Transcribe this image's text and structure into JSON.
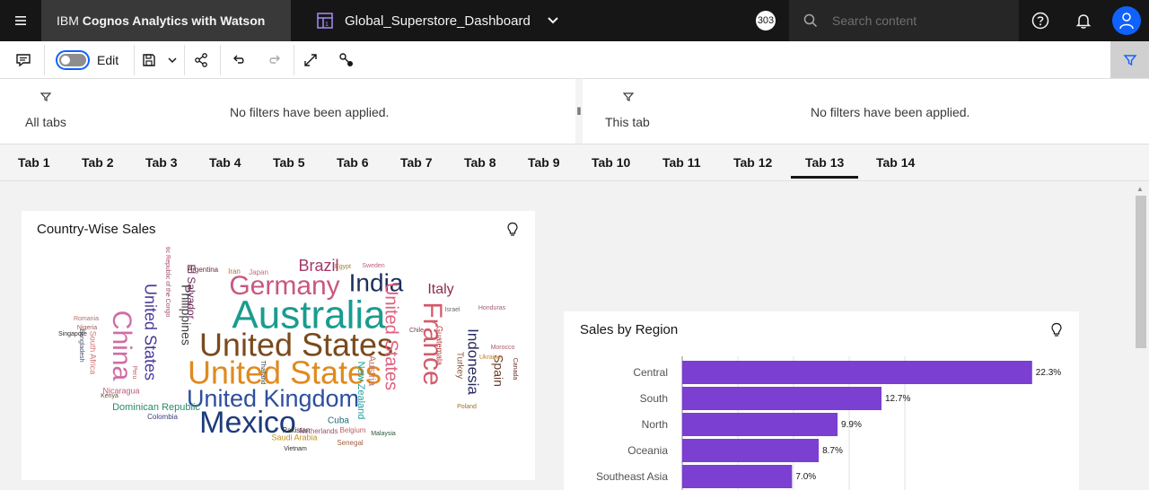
{
  "app": {
    "title_prefix": "IBM ",
    "title_brand": "Cognos Analytics with Watson",
    "dashboard_name": "Global_Superstore_Dashboard",
    "notification_badge": "303",
    "search_placeholder": "Search content"
  },
  "toolbar": {
    "edit_label": "Edit",
    "edit_mode": false
  },
  "filters": {
    "all_tabs_label": "All tabs",
    "all_tabs_message": "No filters have been applied.",
    "this_tab_label": "This tab",
    "this_tab_message": "No filters have been applied.",
    "splitter_glyph": "‖"
  },
  "tabs": [
    "Tab 1",
    "Tab 2",
    "Tab 3",
    "Tab 4",
    "Tab 5",
    "Tab 6",
    "Tab 7",
    "Tab 8",
    "Tab 9",
    "Tab 10",
    "Tab 11",
    "Tab 12",
    "Tab 13",
    "Tab 14"
  ],
  "active_tab": "Tab 13",
  "wordcloud": {
    "title": "Country-Wise Sales",
    "words": [
      {
        "text": "Australia",
        "color": "#1a9c8f"
      },
      {
        "text": "United States",
        "color": "#7a4a1d"
      },
      {
        "text": "United States",
        "color": "#e08a1e"
      },
      {
        "text": "Germany",
        "color": "#c9577f"
      },
      {
        "text": "India",
        "color": "#1e2f5c"
      },
      {
        "text": "United Kingdom",
        "color": "#2d4f9e"
      },
      {
        "text": "Mexico",
        "color": "#1e3b7a"
      },
      {
        "text": "France",
        "color": "#d45a6a"
      },
      {
        "text": "China",
        "color": "#d06ca6"
      },
      {
        "text": "Brazil",
        "color": "#a2386a"
      },
      {
        "text": "Italy",
        "color": "#8a2e4a"
      },
      {
        "text": "Indonesia",
        "color": "#2a2a5e"
      },
      {
        "text": "United States",
        "color": "#e06080"
      },
      {
        "text": "United States",
        "color": "#4a3a9a"
      },
      {
        "text": "Philippines",
        "color": "#3a3a3a"
      },
      {
        "text": "Spain",
        "color": "#6a3a2a"
      },
      {
        "text": "El Salvador",
        "color": "#6a2a5a"
      },
      {
        "text": "Turkey",
        "color": "#8a5a3a"
      },
      {
        "text": "Guatemala",
        "color": "#b03030"
      },
      {
        "text": "Austria",
        "color": "#c07070"
      },
      {
        "text": "New Zealand",
        "color": "#20a0a0"
      },
      {
        "text": "Cuba",
        "color": "#1e6a7a"
      },
      {
        "text": "Dominican Republic",
        "color": "#2a8a6a"
      },
      {
        "text": "Nicaragua",
        "color": "#c05a7a"
      },
      {
        "text": "South Africa",
        "color": "#d07070"
      },
      {
        "text": "Saudi Arabia",
        "color": "#c09020"
      },
      {
        "text": "Colombia",
        "color": "#3a3a7a"
      },
      {
        "text": "Argentina",
        "color": "#6a2a3a"
      },
      {
        "text": "Iran",
        "color": "#c07020"
      },
      {
        "text": "Japan",
        "color": "#c07080"
      },
      {
        "text": "Egypt",
        "color": "#a08030"
      },
      {
        "text": "Sweden",
        "color": "#c06080"
      },
      {
        "text": "Senegal",
        "color": "#a06040"
      },
      {
        "text": "Pakistan",
        "color": "#2a2a2a"
      },
      {
        "text": "Netherlands",
        "color": "#a05070"
      },
      {
        "text": "Belgium",
        "color": "#c06060"
      },
      {
        "text": "Malaysia",
        "color": "#2a5a3a"
      },
      {
        "text": "Vietnam",
        "color": "#2a2a2a"
      },
      {
        "text": "Thailand",
        "color": "#3a3a3a"
      },
      {
        "text": "Bangladesh",
        "color": "#4a4a6a"
      },
      {
        "text": "Nigeria",
        "color": "#a05a5a"
      },
      {
        "text": "Romania",
        "color": "#b07070"
      },
      {
        "text": "Singapore",
        "color": "#2a2a2a"
      },
      {
        "text": "Poland",
        "color": "#a07020"
      },
      {
        "text": "Ukraine",
        "color": "#c08030"
      },
      {
        "text": "Canada",
        "color": "#6a2a2a"
      },
      {
        "text": "Peru",
        "color": "#c06060"
      },
      {
        "text": "Democratic Republic of the Congo",
        "color": "#a04a6a"
      },
      {
        "text": "Honduras",
        "color": "#a06070"
      },
      {
        "text": "Israel",
        "color": "#6a6a6a"
      },
      {
        "text": "Chile",
        "color": "#7a3a4a"
      },
      {
        "text": "Morocco",
        "color": "#b05a6a"
      },
      {
        "text": "Kenya",
        "color": "#6a4a3a"
      }
    ]
  },
  "bar_chart": {
    "title": "Sales by Region",
    "chart_data": {
      "type": "bar",
      "orientation": "horizontal",
      "categories": [
        "Central",
        "South",
        "North",
        "Oceania",
        "Southeast Asia"
      ],
      "values": [
        22.3,
        12.7,
        9.9,
        8.7,
        7.0
      ],
      "labels": [
        "22.3%",
        "12.7%",
        "9.9%",
        "8.7%",
        "7.0%"
      ],
      "xlim": [
        0,
        25
      ],
      "color": "#7b3fd1",
      "grid": true
    }
  }
}
